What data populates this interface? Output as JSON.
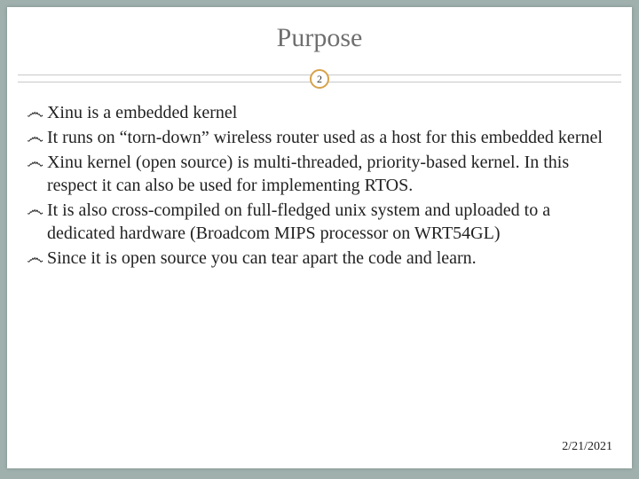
{
  "slide": {
    "title": "Purpose",
    "page_number": "2",
    "bullets": [
      "Xinu is a embedded kernel",
      "It runs on “torn-down” wireless router used as a host for this embedded kernel",
      "Xinu kernel (open source) is multi-threaded, priority-based kernel. In this respect it can also be used for implementing RTOS.",
      "It is also cross-compiled on full-fledged unix system and uploaded to a dedicated hardware (Broadcom MIPS processor on WRT54GL)",
      "Since it is open source you can tear apart the code and learn."
    ],
    "date": "2/21/2021",
    "bullet_glyph": "෴"
  },
  "colors": {
    "background": "#9fb0ad",
    "accent": "#d8a24a"
  }
}
